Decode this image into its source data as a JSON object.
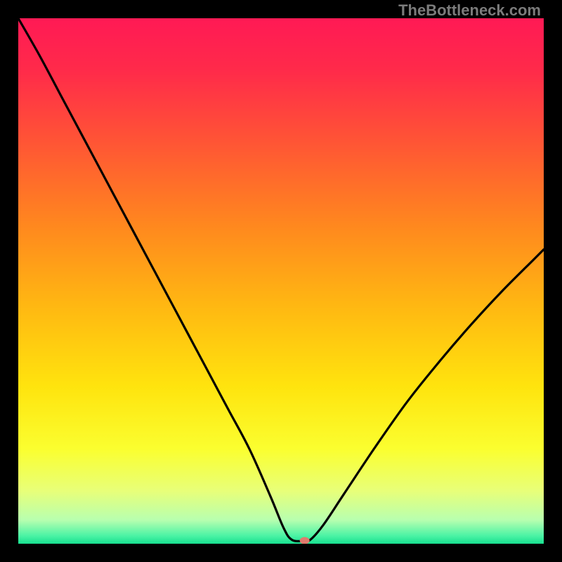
{
  "watermark": "TheBottleneck.com",
  "chart_data": {
    "type": "line",
    "title": "",
    "xlabel": "",
    "ylabel": "",
    "xlim": [
      0,
      100
    ],
    "ylim": [
      0,
      100
    ],
    "gradient_stops": [
      {
        "offset": 0.0,
        "color": "#ff1a55"
      },
      {
        "offset": 0.1,
        "color": "#ff2b4a"
      },
      {
        "offset": 0.25,
        "color": "#ff5a33"
      },
      {
        "offset": 0.4,
        "color": "#ff8a1e"
      },
      {
        "offset": 0.55,
        "color": "#ffb912"
      },
      {
        "offset": 0.7,
        "color": "#ffe40e"
      },
      {
        "offset": 0.82,
        "color": "#fbff30"
      },
      {
        "offset": 0.9,
        "color": "#e8ff7a"
      },
      {
        "offset": 0.955,
        "color": "#b8ffb0"
      },
      {
        "offset": 0.985,
        "color": "#4bf3a5"
      },
      {
        "offset": 1.0,
        "color": "#18e08f"
      }
    ],
    "series": [
      {
        "name": "bottleneck-curve",
        "x": [
          0,
          4,
          8,
          12,
          16,
          20,
          24,
          28,
          32,
          36,
          40,
          44,
          48,
          50.5,
          52,
          54,
          55.5,
          58,
          62,
          68,
          74,
          80,
          86,
          92,
          98,
          100
        ],
        "y": [
          100,
          93,
          85.5,
          78,
          70.5,
          63,
          55.5,
          48,
          40.5,
          33,
          25.5,
          18,
          9,
          3,
          0.8,
          0.5,
          0.7,
          3.5,
          9.5,
          18.5,
          27,
          34.5,
          41.5,
          48,
          54,
          56
        ]
      }
    ],
    "marker": {
      "x": 54.5,
      "y": 0.6,
      "color": "#e07a6d"
    }
  }
}
